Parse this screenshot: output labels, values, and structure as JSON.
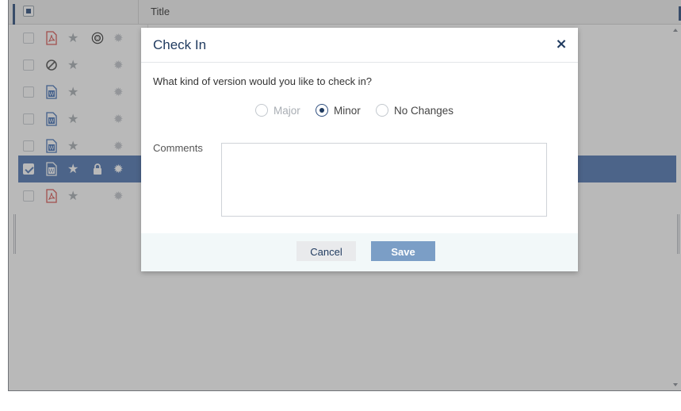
{
  "list": {
    "title_header": "Title",
    "rows": [
      {
        "type_icon": "pdf-icon",
        "starred": false,
        "status_icon": "checked-out-icon",
        "selected": false
      },
      {
        "type_icon": "blocked-icon",
        "starred": false,
        "status_icon": "",
        "selected": false
      },
      {
        "type_icon": "word-icon",
        "starred": false,
        "status_icon": "",
        "selected": false
      },
      {
        "type_icon": "word-icon",
        "starred": false,
        "status_icon": "",
        "selected": false
      },
      {
        "type_icon": "word-icon",
        "starred": false,
        "status_icon": "",
        "selected": false
      },
      {
        "type_icon": "word-icon",
        "starred": true,
        "status_icon": "lock-icon",
        "selected": true
      },
      {
        "type_icon": "pdf-icon",
        "starred": false,
        "status_icon": "",
        "selected": false
      }
    ]
  },
  "dialog": {
    "title": "Check In",
    "close_label": "×",
    "question": "What kind of version would you like to check in?",
    "options": [
      {
        "label": "Major",
        "checked": false,
        "disabled": true
      },
      {
        "label": "Minor",
        "checked": true,
        "disabled": false
      },
      {
        "label": "No Changes",
        "checked": false,
        "disabled": false
      }
    ],
    "comments_label": "Comments",
    "comments_value": "",
    "cancel_label": "Cancel",
    "save_label": "Save"
  },
  "colors": {
    "primary": "#1f3a5f",
    "selected_row": "#4f77b2",
    "save_button": "#7b9ec6",
    "pdf_red": "#d9534f",
    "word_blue": "#3f6fb5"
  }
}
